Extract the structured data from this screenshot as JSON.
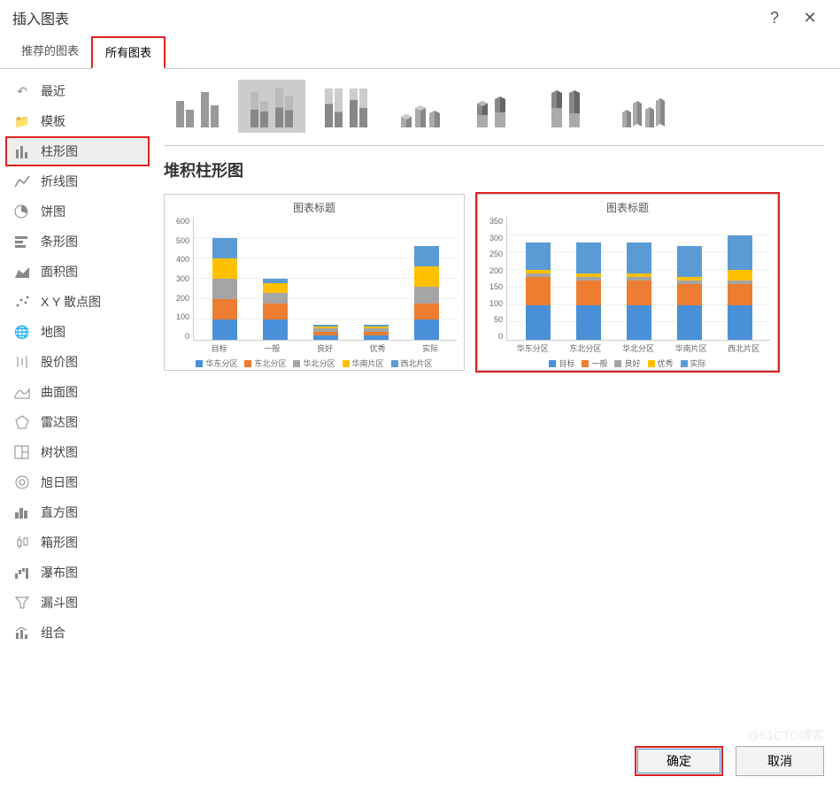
{
  "dialog": {
    "title": "插入图表",
    "help": "?",
    "close": "✕"
  },
  "tabs": {
    "recommended": "推荐的图表",
    "all": "所有图表"
  },
  "sidebar": {
    "items": [
      {
        "label": "最近"
      },
      {
        "label": "模板"
      },
      {
        "label": "柱形图"
      },
      {
        "label": "折线图"
      },
      {
        "label": "饼图"
      },
      {
        "label": "条形图"
      },
      {
        "label": "面积图"
      },
      {
        "label": "X Y 散点图"
      },
      {
        "label": "地图"
      },
      {
        "label": "股价图"
      },
      {
        "label": "曲面图"
      },
      {
        "label": "雷达图"
      },
      {
        "label": "树状图"
      },
      {
        "label": "旭日图"
      },
      {
        "label": "直方图"
      },
      {
        "label": "箱形图"
      },
      {
        "label": "瀑布图"
      },
      {
        "label": "漏斗图"
      },
      {
        "label": "组合"
      }
    ]
  },
  "subtype_title": "堆积柱形图",
  "footer": {
    "ok": "确定",
    "cancel": "取消"
  },
  "watermark": "@51CTO博客",
  "preview": {
    "left": {
      "title": "图表标题",
      "legend": [
        "华东分区",
        "东北分区",
        "华北分区",
        "华南片区",
        "西北片区"
      ]
    },
    "right": {
      "title": "图表标题",
      "legend": [
        "目标",
        "一般",
        "良好",
        "优秀",
        "实际"
      ]
    }
  },
  "chart_data": [
    {
      "type": "bar",
      "stacked": true,
      "title": "图表标题",
      "categories": [
        "目标",
        "一般",
        "良好",
        "优秀",
        "实际"
      ],
      "series": [
        {
          "name": "华东分区",
          "values": [
            100,
            100,
            20,
            20,
            100
          ]
        },
        {
          "name": "东北分区",
          "values": [
            100,
            80,
            20,
            20,
            80
          ]
        },
        {
          "name": "华北分区",
          "values": [
            100,
            50,
            15,
            15,
            80
          ]
        },
        {
          "name": "华南片区",
          "values": [
            100,
            50,
            10,
            10,
            100
          ]
        },
        {
          "name": "西北片区",
          "values": [
            100,
            20,
            10,
            10,
            100
          ]
        }
      ],
      "ylim": [
        0,
        600
      ],
      "ystep": 100
    },
    {
      "type": "bar",
      "stacked": true,
      "title": "图表标题",
      "categories": [
        "华东分区",
        "东北分区",
        "华北分区",
        "华南片区",
        "西北片区"
      ],
      "series": [
        {
          "name": "目标",
          "values": [
            100,
            100,
            100,
            100,
            100
          ]
        },
        {
          "name": "一般",
          "values": [
            80,
            70,
            70,
            60,
            60
          ]
        },
        {
          "name": "良好",
          "values": [
            10,
            10,
            10,
            10,
            10
          ]
        },
        {
          "name": "优秀",
          "values": [
            10,
            10,
            10,
            10,
            30
          ]
        },
        {
          "name": "实际",
          "values": [
            80,
            90,
            90,
            90,
            100
          ]
        }
      ],
      "ylim": [
        0,
        350
      ],
      "ystep": 50
    }
  ]
}
